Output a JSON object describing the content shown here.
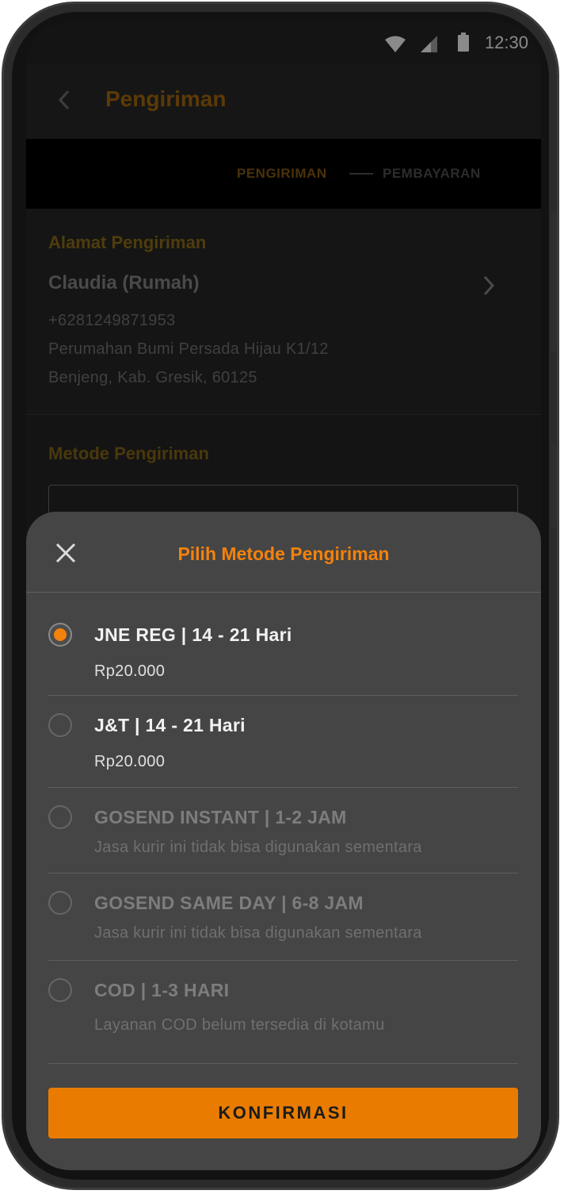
{
  "status_bar": {
    "time": "12:30"
  },
  "app_bar": {
    "title": "Pengiriman"
  },
  "stepper": {
    "step1": "PENGIRIMAN",
    "step2": "PEMBAYARAN"
  },
  "address": {
    "section_title": "Alamat Pengiriman",
    "name": "Claudia (Rumah)",
    "phone": "+6281249871953",
    "line1": "Perumahan Bumi Persada Hijau K1/12",
    "line2": "Benjeng, Kab. Gresik, 60125"
  },
  "method": {
    "section_title": "Metode Pengiriman"
  },
  "sheet": {
    "title": "Pilih Metode Pengiriman",
    "options": [
      {
        "title": "JNE REG | 14 - 21 Hari",
        "subtitle": "Rp20.000",
        "selected": true,
        "enabled": true
      },
      {
        "title": "J&T | 14 - 21 Hari",
        "subtitle": "Rp20.000",
        "selected": false,
        "enabled": true
      },
      {
        "title": "GOSEND INSTANT | 1-2 JAM",
        "subtitle": "Jasa kurir ini tidak bisa digunakan sementara",
        "selected": false,
        "enabled": false
      },
      {
        "title": "GOSEND SAME DAY | 6-8 JAM",
        "subtitle": "Jasa kurir ini tidak bisa digunakan sementara",
        "selected": false,
        "enabled": false
      },
      {
        "title": "COD | 1-3 HARI",
        "subtitle": "Layanan COD belum tersedia di kotamu",
        "selected": false,
        "enabled": false
      }
    ],
    "confirm_label": "KONFIRMASI"
  },
  "colors": {
    "accent": "#f5820a",
    "button": "#e97c00",
    "sheet_bg": "#454545"
  },
  "icons": [
    "wifi-icon",
    "signal-icon",
    "battery-icon",
    "back-icon",
    "chevron-right-icon",
    "close-icon",
    "radio-icon"
  ]
}
